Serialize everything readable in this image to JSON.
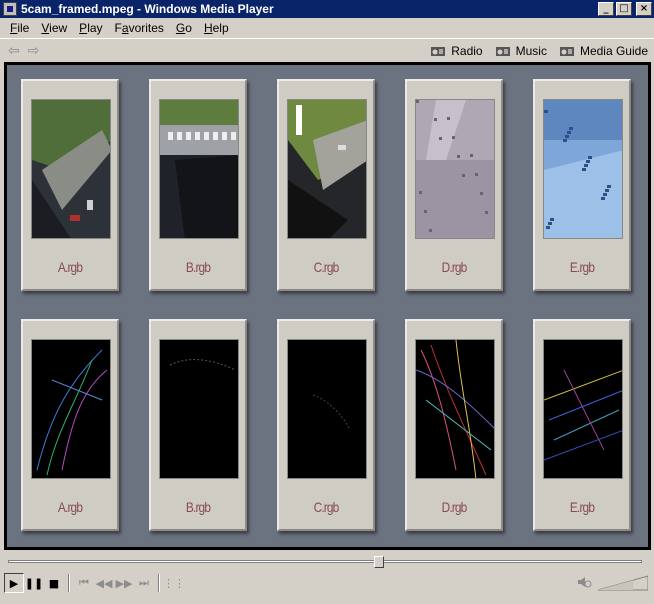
{
  "window": {
    "title": "5cam_framed.mpeg - Windows Media Player"
  },
  "menu": [
    {
      "label": "File",
      "accel": "F",
      "rest": "ile"
    },
    {
      "label": "View",
      "accel": "V",
      "rest": "iew"
    },
    {
      "label": "Play",
      "accel": "P",
      "rest": "lay"
    },
    {
      "label": "Favorites",
      "accel": "a",
      "pre": "F",
      "rest": "vorites"
    },
    {
      "label": "Go",
      "accel": "G",
      "rest": "o"
    },
    {
      "label": "Help",
      "accel": "H",
      "rest": "elp"
    }
  ],
  "navlinks": [
    {
      "label": "Radio",
      "icon": "radio-icon"
    },
    {
      "label": "Music",
      "icon": "music-icon"
    },
    {
      "label": "Media Guide",
      "icon": "media-guide-icon"
    }
  ],
  "video": {
    "top_row": [
      {
        "label": "A.rgb",
        "scene": "aerial-a"
      },
      {
        "label": "B.rgb",
        "scene": "aerial-b"
      },
      {
        "label": "C.rgb",
        "scene": "aerial-c"
      },
      {
        "label": "D.rgb",
        "scene": "aerial-d"
      },
      {
        "label": "E.rgb",
        "scene": "aerial-e"
      }
    ],
    "bottom_row": [
      {
        "label": "A.rgb",
        "scene": "tracks-a"
      },
      {
        "label": "B.rgb",
        "scene": "tracks-b"
      },
      {
        "label": "C.rgb",
        "scene": "tracks-c"
      },
      {
        "label": "D.rgb",
        "scene": "tracks-d"
      },
      {
        "label": "E.rgb",
        "scene": "tracks-e"
      }
    ]
  },
  "seek": {
    "position_fraction": 0.585
  },
  "volume": {
    "level_fraction": 0.7
  }
}
